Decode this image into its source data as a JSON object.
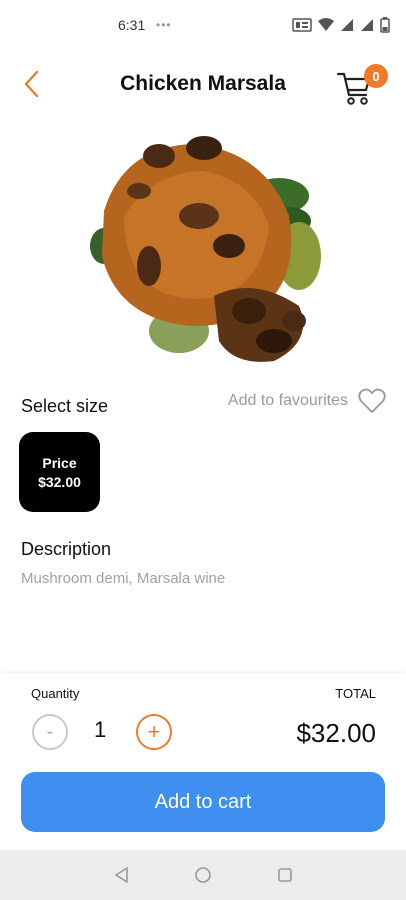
{
  "status_bar": {
    "time": "6:31",
    "dots": "•••"
  },
  "header": {
    "title": "Chicken Marsala",
    "cart_count": "0"
  },
  "size_section": {
    "label": "Select size",
    "favourite_label": "Add to favourites"
  },
  "price_option": {
    "label": "Price",
    "value": "$32.00"
  },
  "description": {
    "title": "Description",
    "text": "Mushroom demi, Marsala wine"
  },
  "order": {
    "quantity_label": "Quantity",
    "total_label": "TOTAL",
    "minus_label": "-",
    "plus_label": "+",
    "quantity": "1",
    "total": "$32.00",
    "add_to_cart": "Add to cart"
  },
  "colors": {
    "accent": "#f07a2a",
    "primary_button": "#3f8ff0",
    "muted_text": "#a2a2a2"
  }
}
